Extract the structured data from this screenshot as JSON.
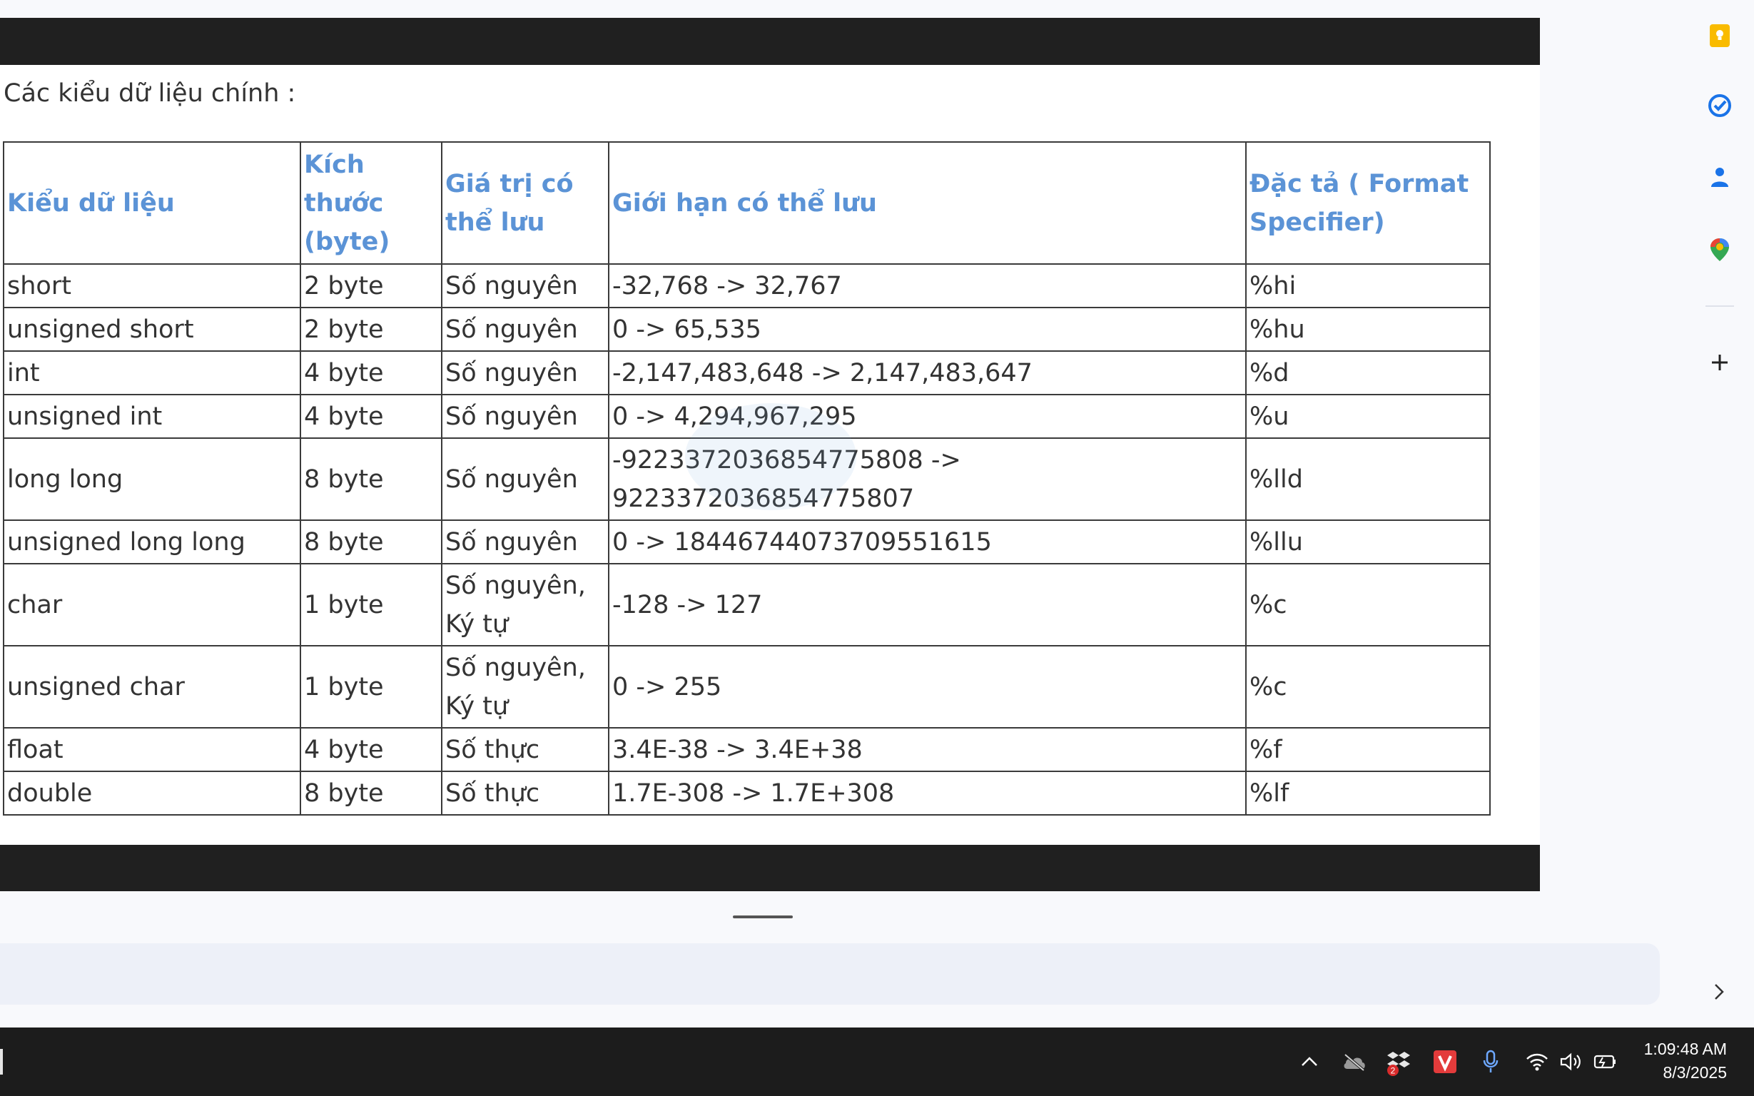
{
  "document": {
    "intro_text": "Các kiểu dữ liệu chính :",
    "table": {
      "headers": [
        "Kiểu dữ liệu",
        "Kích thước (byte)",
        "Giá trị có thể lưu",
        "Giới hạn có thể lưu",
        "Đặc tả ( Format Specifier)"
      ],
      "rows": [
        [
          "short",
          "2 byte",
          "Số nguyên",
          "-32,768 -> 32,767",
          "%hi"
        ],
        [
          "unsigned short",
          "2 byte",
          "Số nguyên",
          "0 -> 65,535",
          "%hu"
        ],
        [
          "int",
          "4 byte",
          "Số nguyên",
          "-2,147,483,648 -> 2,147,483,647",
          "%d"
        ],
        [
          "unsigned int",
          "4 byte",
          "Số nguyên",
          "0 -> 4,294,967,295",
          "%u"
        ],
        [
          "long long",
          "8 byte",
          "Số nguyên",
          "-9223372036854775808 -> 9223372036854775807",
          "%lld"
        ],
        [
          "unsigned long long",
          "8 byte",
          "Số nguyên",
          "0 -> 18446744073709551615",
          "%llu"
        ],
        [
          "char",
          "1 byte",
          "Số nguyên, Ký tự",
          "-128 -> 127",
          "%c"
        ],
        [
          "unsigned char",
          "1 byte",
          "Số nguyên, Ký tự",
          "0 -> 255",
          "%c"
        ],
        [
          "float",
          "4 byte",
          "Số thực",
          "3.4E-38 -> 3.4E+38",
          "%f"
        ],
        [
          "double",
          "8 byte",
          "Số thực",
          "1.7E-308 -> 1.7E+308",
          "%lf"
        ]
      ]
    }
  },
  "side_panel": {
    "icons": [
      "keep-notes-icon",
      "tasks-icon",
      "contacts-icon",
      "maps-icon",
      "add-icon"
    ]
  },
  "taskbar": {
    "tray_icons": [
      "chevron-up-icon",
      "onedrive-offline-icon",
      "dropbox-icon",
      "vivaldi-icon",
      "microphone-icon",
      "wifi-icon",
      "volume-icon",
      "battery-icon"
    ],
    "dropbox_badge": "2",
    "time": "1:09:48 AM",
    "date": "8/3/2025"
  },
  "colors": {
    "header_text": "#5b93d6",
    "dark_bar": "#202020",
    "taskbar": "#1c1c1c",
    "keep_yellow": "#f9bb00",
    "tasks_blue": "#1a73e8"
  }
}
